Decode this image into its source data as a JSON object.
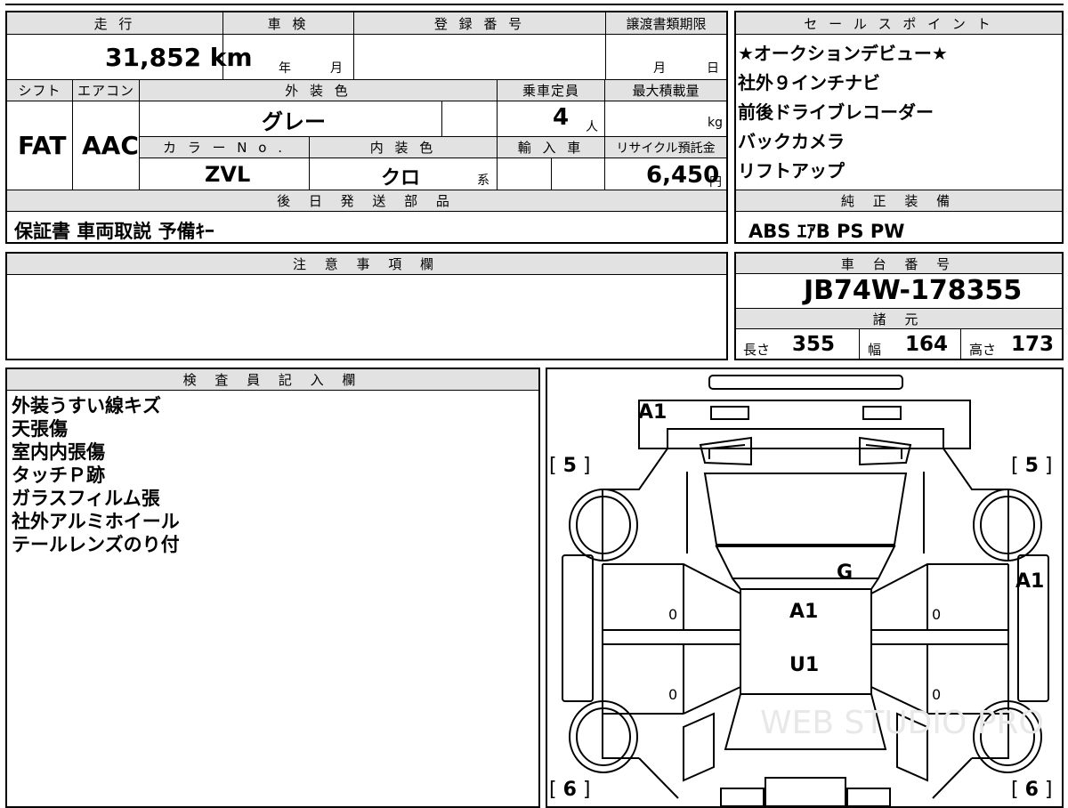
{
  "main_sheet": {
    "headers": {
      "mileage": "走 行",
      "inspection": "車 検",
      "registration": "登 録 番 号",
      "transfer_deadline": "譲渡書類期限",
      "shift": "シフト",
      "aircon": "エアコン",
      "exterior_color": "外 装 色",
      "capacity": "乗車定員",
      "max_load": "最大積載量",
      "color_no": "カ ラ ー N o .",
      "interior_color": "内 装 色",
      "import": "輸 入 車",
      "recycle_fee": "リサイクル預託金",
      "later_parts": "後 日 発 送 部 品"
    },
    "mileage": "31,852 km",
    "inspection_year_unit": "年",
    "inspection_month_unit": "月",
    "transfer_month_unit": "月",
    "transfer_day_unit": "日",
    "shift": "FAT",
    "aircon": "AAC",
    "exterior_color": "グレー",
    "capacity": "4",
    "capacity_unit": "人",
    "max_load_unit": "kg",
    "color_no": "ZVL",
    "interior_color": "クロ",
    "interior_color_suffix": "系",
    "recycle_fee": "6,450",
    "recycle_unit": "円",
    "later_parts": "保証書 車両取説 予備ｷｰ"
  },
  "sales_points": {
    "header": "セ ー ル ス ポ イ ン ト",
    "items": [
      "★オークションデビュー★",
      "社外９インチナビ",
      "前後ドライブレコーダー",
      "バックカメラ",
      "リフトアップ"
    ]
  },
  "standard_equipment": {
    "header": "純 正 装 備",
    "value": "ABS ｴｱB PS PW"
  },
  "notes": {
    "header": "注 意 事 項 欄"
  },
  "chassis": {
    "header": "車 台 番 号",
    "value": "JB74W-178355"
  },
  "specs": {
    "header": "諸 元",
    "length_label": "長さ",
    "length": "355",
    "width_label": "幅",
    "width": "164",
    "height_label": "高さ",
    "height": "173"
  },
  "inspector": {
    "header": "検 査 員 記 入 欄",
    "lines": [
      "外装うすい線キズ",
      "天張傷",
      "室内内張傷",
      "タッチＰ跡",
      "ガラスフィルム張",
      "社外アルミホイール",
      "テールレンズのり付"
    ]
  },
  "diagram": {
    "marks": {
      "front_bumper": "A1",
      "front_left_tire": "5",
      "front_right_tire": "5",
      "rear_left_tire": "6",
      "rear_right_tire": "6",
      "windshield": "G",
      "roof_front": "A1",
      "roof_rear": "U1",
      "right_side": "A1",
      "left_front_door": "0",
      "left_rear_door": "0",
      "right_front_door": "0",
      "right_rear_door": "0"
    },
    "watermark": "WEB STUDIO PRO"
  }
}
